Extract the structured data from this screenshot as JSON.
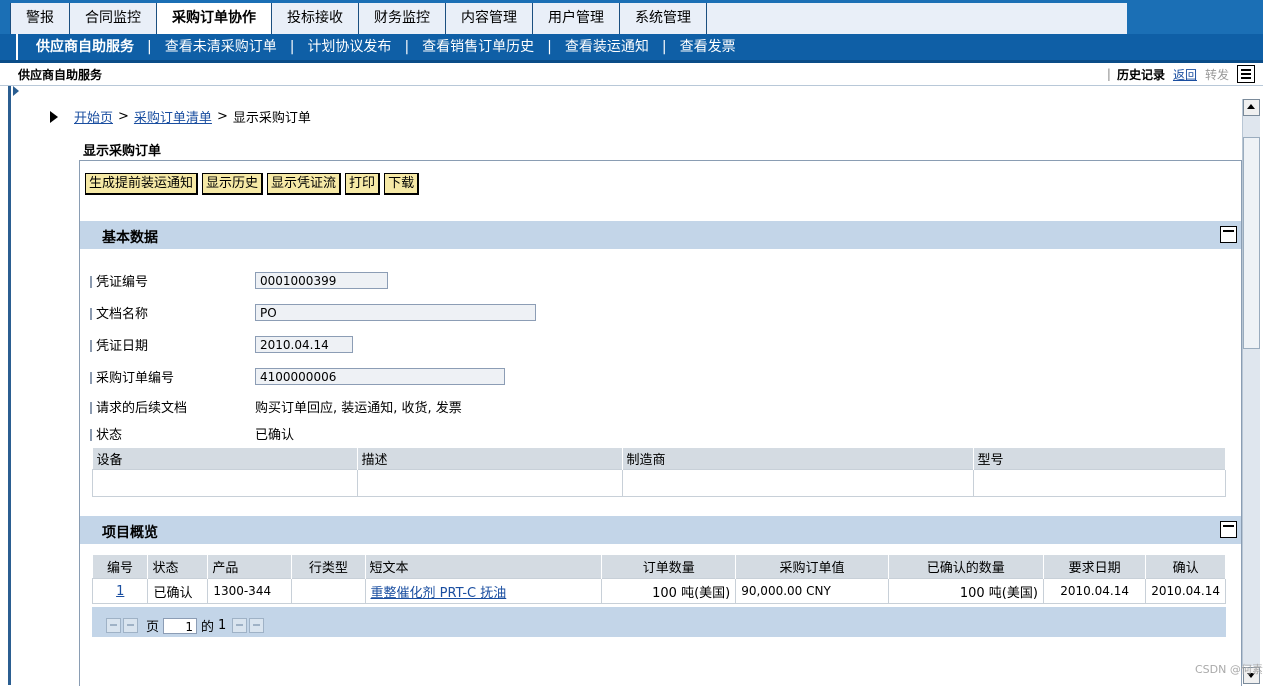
{
  "top_tabs": [
    "警报",
    "合同监控",
    "采购订单协作",
    "投标接收",
    "财务监控",
    "内容管理",
    "用户管理",
    "系统管理"
  ],
  "sub_nav": [
    "供应商自助服务",
    "查看未清采购订单",
    "计划协议发布",
    "查看销售订单历史",
    "查看装运通知",
    "查看发票"
  ],
  "sub_nav_separator": "|",
  "title_bar": {
    "title": "供应商自助服务",
    "pipe": "|",
    "history": "历史记录",
    "back": "返回",
    "forward": "转发"
  },
  "breadcrumb": {
    "home": "开始页",
    "gt1": ">",
    "list": "采购订单清单",
    "gt2": ">",
    "current": "显示采购订单"
  },
  "page_title": "显示采购订单",
  "toolbar": {
    "btn1": "生成提前装运通知",
    "btn2": "显示历史",
    "btn3": "显示凭证流",
    "btn4": "打印",
    "btn5": "下载"
  },
  "basic": {
    "title": "基本数据",
    "doc_no_label": "凭证编号",
    "doc_no": "0001000399",
    "doc_name_label": "文档名称",
    "doc_name": "PO",
    "doc_date_label": "凭证日期",
    "doc_date": "2010.04.14",
    "po_no_label": "采购订单编号",
    "po_no": "4100000006",
    "followup_label": "请求的后续文档",
    "followup": "购买订单回应, 装运通知, 收货, 发票",
    "status_label": "状态",
    "status": "已确认",
    "equip_headers": [
      "设备",
      "描述",
      "制造商",
      "型号"
    ]
  },
  "items": {
    "title": "项目概览",
    "headers": [
      "编号",
      "状态",
      "产品",
      "行类型",
      "短文本",
      "订单数量",
      "采购订单值",
      "已确认的数量",
      "要求日期",
      "确认"
    ],
    "row": {
      "no": "1",
      "status": "已确认",
      "product": "1300-344",
      "line_type": "",
      "short_text": "重整催化剂 PRT-C 抚油",
      "qty": "100 吨(美国)",
      "value": "90,000.00 CNY",
      "confirmed_qty": "100 吨(美国)",
      "req_date": "2010.04.14",
      "confirm": "2010.04.14"
    },
    "pager": {
      "page_label": "页",
      "page": "1",
      "of_label": "的",
      "total": "1"
    }
  },
  "watermark": "CSDN @何素"
}
